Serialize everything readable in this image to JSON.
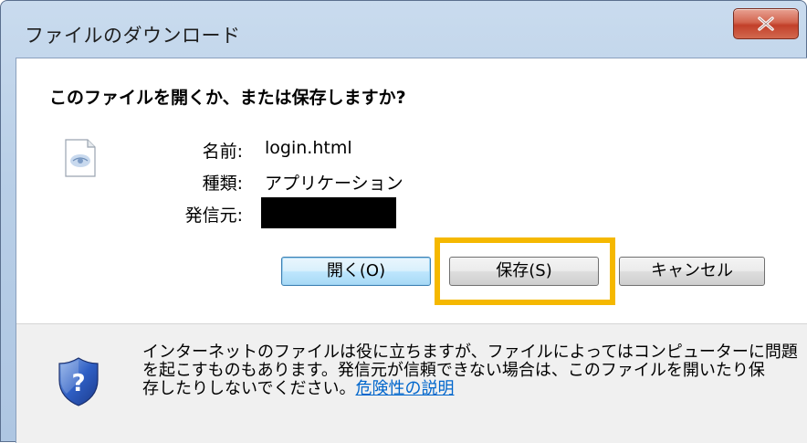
{
  "window": {
    "title": "ファイルのダウンロード",
    "close_label": "X"
  },
  "dialog": {
    "question": "このファイルを開くか、または保存しますか?",
    "file_icon": "html-file-icon",
    "fields": [
      {
        "label": "名前:",
        "value": "login.html"
      },
      {
        "label": "種類:",
        "value": "アプリケーション"
      },
      {
        "label": "発信元:",
        "value": ""
      }
    ]
  },
  "buttons": {
    "open": "開く(O)",
    "save": "保存(S)",
    "cancel": "キャンセル"
  },
  "footer": {
    "icon": "shield-question-icon",
    "warning_lines": [
      "インターネットのファイルは役に立ちますが、ファイルによってはコンピューターに問題",
      "を起こすものもあります。発信元が信頼できない場合は、このファイルを開いたり保",
      "存したりしないでください。"
    ],
    "link_text": "危険性の説明"
  },
  "colors": {
    "highlight": "#f5b800",
    "link": "#0066cc",
    "close_button": "#c2402a"
  }
}
